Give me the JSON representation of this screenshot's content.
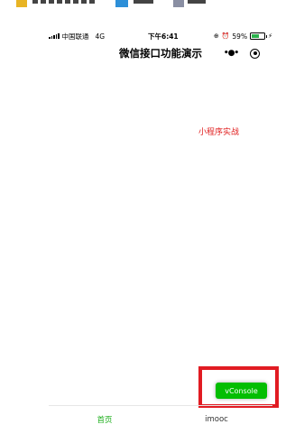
{
  "status_bar": {
    "carrier": "中国联通",
    "network": "4G",
    "time": "下午6:41",
    "battery": "59%",
    "battery_level": 0.59
  },
  "nav": {
    "title": "微信接口功能演示",
    "more_icon": "more-dots-icon",
    "close_icon": "mini-program-close-icon"
  },
  "content": {
    "text": "小程序实战",
    "text_color": "#e02020"
  },
  "vconsole": {
    "label": "vConsole",
    "color": "#04be02"
  },
  "tab_bar": {
    "items": [
      {
        "label": "首页",
        "active": true
      },
      {
        "label": "imooc",
        "active": false
      }
    ],
    "active_color": "#1aad19"
  },
  "highlight_color": "#e11b22"
}
